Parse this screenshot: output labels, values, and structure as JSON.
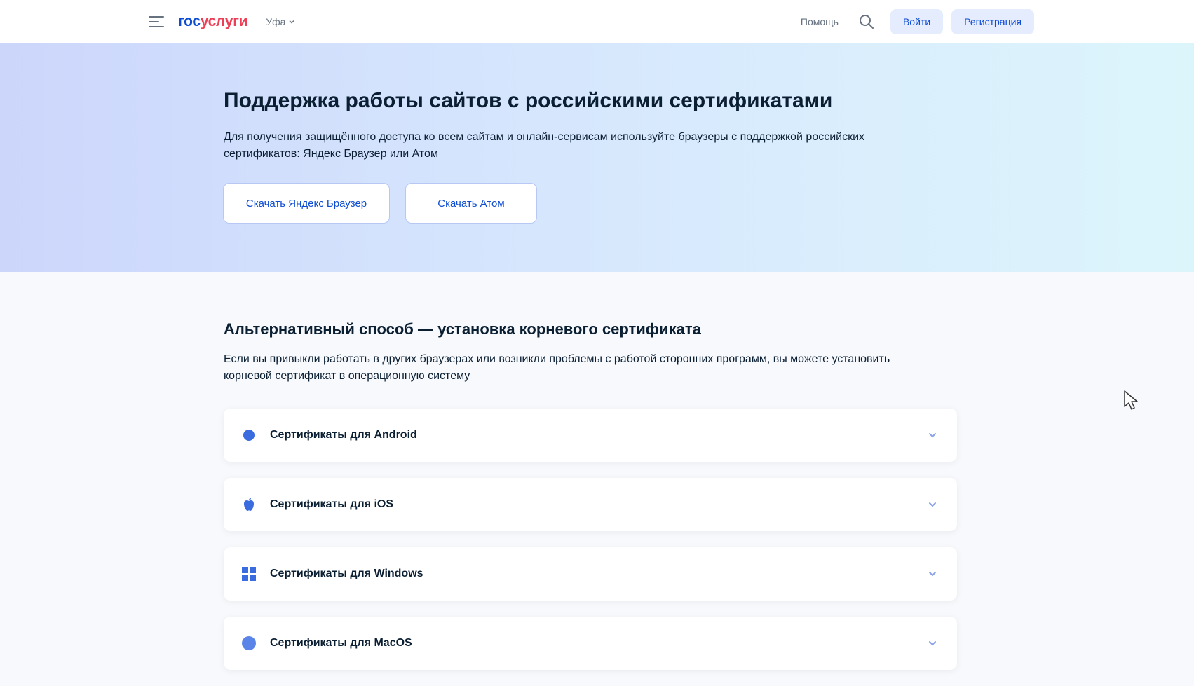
{
  "header": {
    "logo_part1": "гос",
    "logo_part2": "услуги",
    "region_label": "Уфа",
    "help_label": "Помощь",
    "login_label": "Войти",
    "register_label": "Регистрация"
  },
  "hero": {
    "title": "Поддержка работы сайтов с российскими сертификатами",
    "description": "Для получения защищённого доступа ко всем сайтам и онлайн-сервисам используйте браузеры с поддержкой российских сертификатов: Яндекс Браузер или Атом",
    "button_yandex": "Скачать Яндекс Браузер",
    "button_atom": "Скачать Атом"
  },
  "section": {
    "title": "Альтернативный способ — установка корневого сертификата",
    "description": "Если вы привыкли работать в других браузерах или возникли проблемы с работой сторонних программ, вы можете установить корневой сертификат в операционную систему",
    "items": [
      {
        "label": "Сертификаты для Android",
        "icon": "android-icon"
      },
      {
        "label": "Сертификаты для iOS",
        "icon": "apple-icon"
      },
      {
        "label": "Сертификаты для Windows",
        "icon": "windows-icon"
      },
      {
        "label": "Сертификаты для MacOS",
        "icon": "macos-icon"
      }
    ]
  },
  "colors": {
    "brand_blue": "#0d4cd3",
    "brand_red": "#ee3f58",
    "text_dark": "#0b1f33",
    "button_bg": "#e4ecfd"
  }
}
